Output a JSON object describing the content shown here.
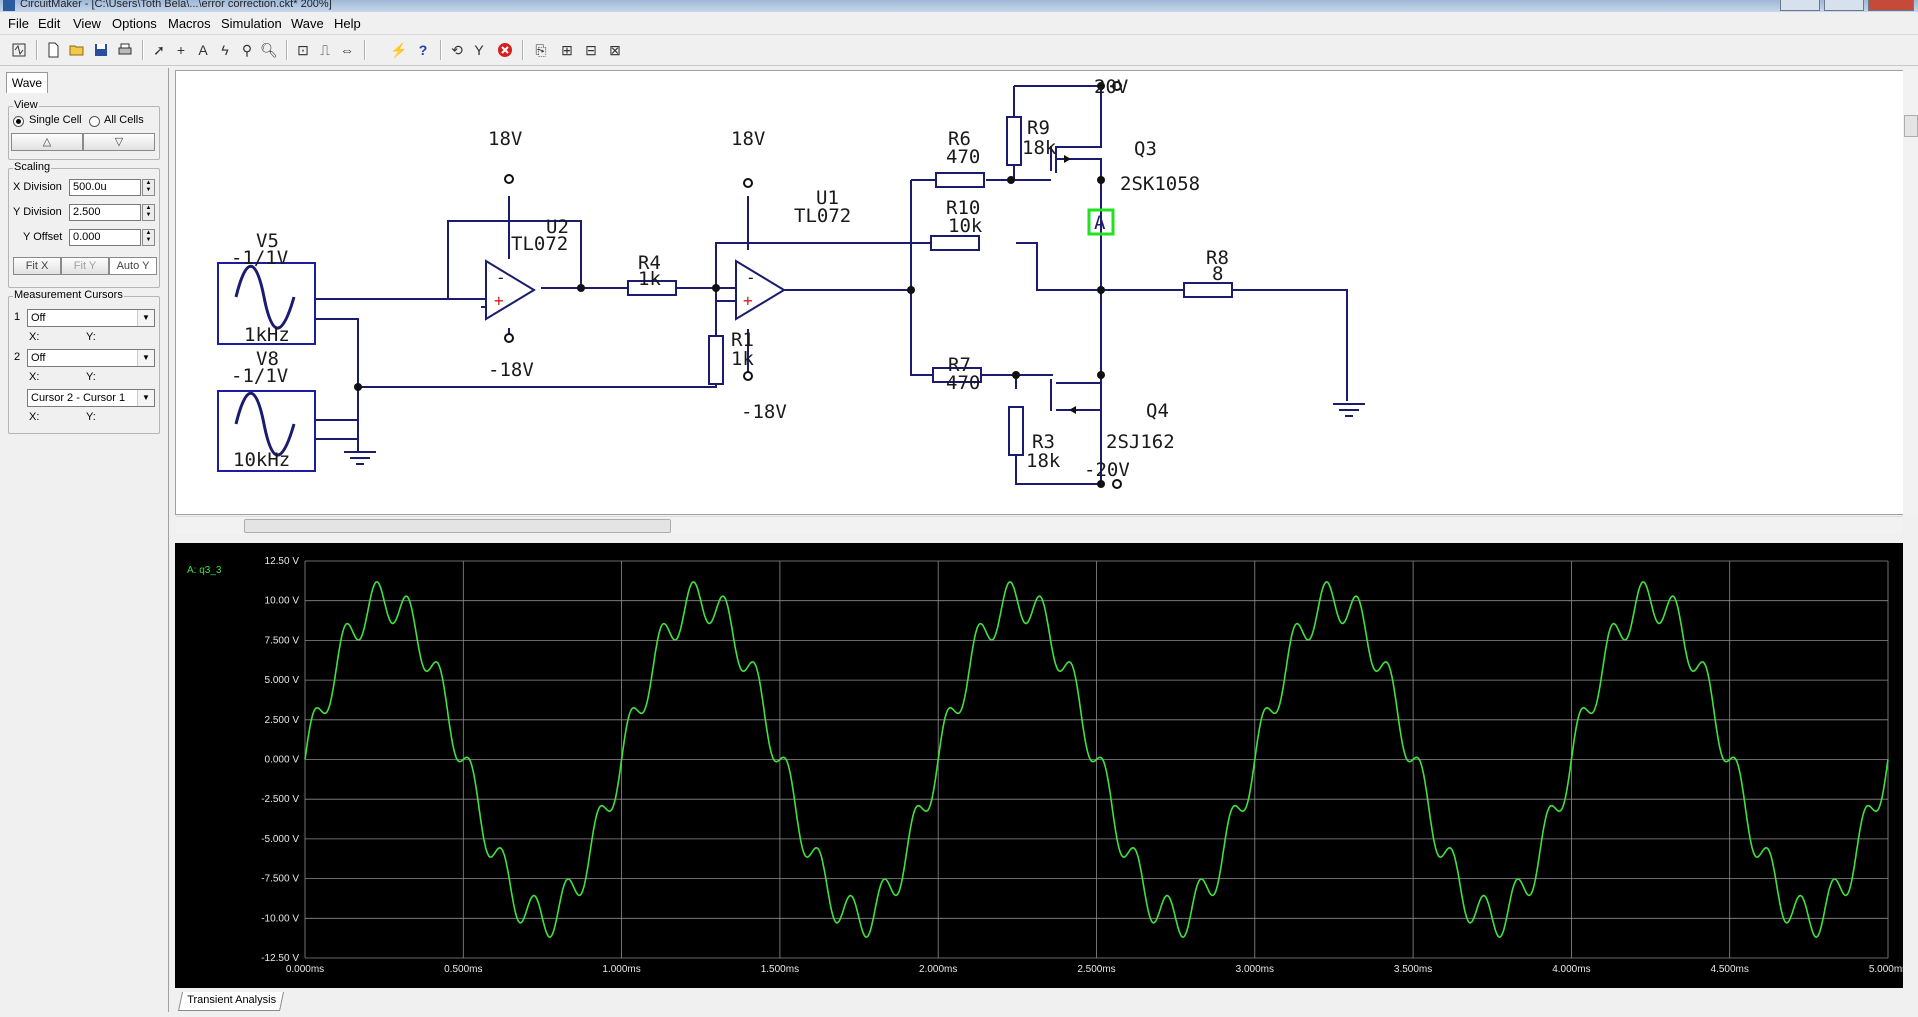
{
  "window": {
    "title": "CircuitMaker - [C:\\Users\\Toth Bela\\...\\error correction.ckt* 200%]"
  },
  "menu": [
    "File",
    "Edit",
    "View",
    "Options",
    "Macros",
    "Simulation",
    "Wave",
    "Help"
  ],
  "toolbar_icons": [
    "wave-icon",
    "new-file-icon",
    "open-folder-icon",
    "save-icon",
    "print-icon",
    "arrow-pointer-icon",
    "wire-cross-icon",
    "text-tool-icon",
    "probe-icon",
    "magnify-probe-icon",
    "zoom-icon",
    "zoom-fit-icon",
    "zoom-area-icon",
    "pan-icon",
    "digital-sim-icon",
    "help-icon",
    "reset-icon",
    "step-icon",
    "stop-icon",
    "analog-sim-icon",
    "run-icon",
    "trace-icon",
    "scope-icon"
  ],
  "panel": {
    "tab": "Wave",
    "view": {
      "label": "View",
      "single_cell": "Single Cell",
      "all_cells": "All Cells",
      "up": "△",
      "down": "▽"
    },
    "scaling": {
      "label": "Scaling",
      "x_division_label": "X Division",
      "x_division": "500.0u",
      "y_division_label": "Y Division",
      "y_division": "2.500",
      "y_offset_label": "Y Offset",
      "y_offset": "0.000",
      "fit_x": "Fit X",
      "fit_y": "Fit Y",
      "auto_y": "Auto Y"
    },
    "cursors": {
      "label": "Measurement Cursors",
      "c1_num": "1",
      "c1_value": "Off",
      "c2_num": "2",
      "c2_value": "Off",
      "x_label": "X:",
      "y_label": "Y:",
      "diff_value": "Cursor 2 - Cursor 1"
    }
  },
  "schematic": {
    "v5_name": "V5",
    "v5_value": "-1/1V",
    "v5_freq": "1kHz",
    "v8_name": "V8",
    "v8_value": "-1/1V",
    "v8_freq": "10kHz",
    "u2_name": "U2",
    "u2_part": "TL072",
    "u2_vpos": "18V",
    "u2_vneg": "-18V",
    "u1_name": "U1",
    "u1_part": "TL072",
    "u1_vpos": "18V",
    "u1_vneg": "-18V",
    "r4_name": "R4",
    "r4_value": "1k",
    "r1_name": "R1",
    "r1_value": "1k",
    "r6_name": "R6",
    "r6_value": "470",
    "r9_name": "R9",
    "r9_value": "18k",
    "r10_name": "R10",
    "r10_value": "10k",
    "r7_name": "R7",
    "r7_value": "470",
    "r3_name": "R3",
    "r3_value": "18k",
    "r8_name": "R8",
    "r8_value": "8",
    "q3_name": "Q3",
    "q3_part": "2SK1058",
    "q4_name": "Q4",
    "q4_part": "2SJ162",
    "vplus": "20V",
    "vminus": "-20V",
    "probe_label": "A",
    "opamp_minus": "-",
    "opamp_plus": "+"
  },
  "scope": {
    "trace_label": "A: q3_3",
    "trace_color": "#3fe13f",
    "grid_color": "#8c8c8c",
    "tab": "Transient Analysis"
  },
  "chart_data": {
    "type": "line",
    "title": "",
    "series": [
      {
        "name": "A: q3_3",
        "description_formula": "10*sin(2*pi*1000*t) + 1.3*sin(2*pi*10000*t)"
      }
    ],
    "x": {
      "min": 0,
      "max": 0.005,
      "unit": "s",
      "tick_labels": [
        "0.000ms",
        "0.500ms",
        "1.000ms",
        "1.500ms",
        "2.000ms",
        "2.500ms",
        "3.000ms",
        "3.500ms",
        "4.000ms",
        "4.500ms",
        "5.000ms"
      ]
    },
    "y": {
      "min": -12.5,
      "max": 12.5,
      "unit": "V",
      "tick_labels": [
        "12.50 V",
        "10.00 V",
        "7.500 V",
        "5.000 V",
        "2.500 V",
        "0.000 V",
        "-2.500 V",
        "-5.000 V",
        "-7.500 V",
        "-10.00 V",
        "-12.50 V"
      ]
    },
    "grid": true,
    "fundamental_hz": 1000,
    "fundamental_amplitude_v": 10,
    "ripple_hz": 10000,
    "ripple_amplitude_v": 1.3
  }
}
